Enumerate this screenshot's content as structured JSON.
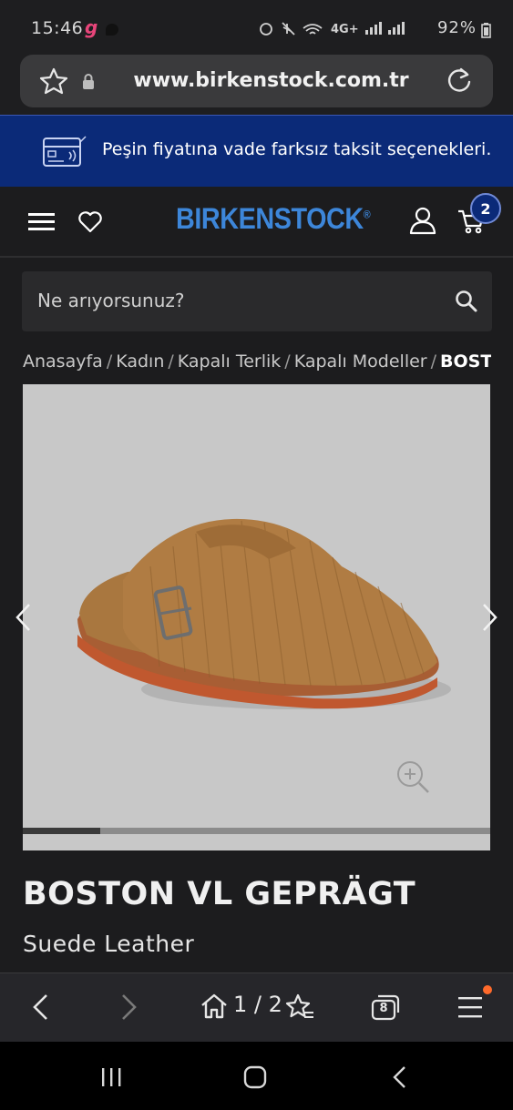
{
  "status_bar": {
    "time": "15:46",
    "app_glyph": "g",
    "battery": "92%",
    "icons": [
      "alarm-icon",
      "mute-icon",
      "wifi-icon",
      "signal-icon",
      "battery-icon"
    ]
  },
  "browser": {
    "url": "www.birkenstock.com.tr",
    "tab_counter": "8",
    "pager": "1 / 2"
  },
  "promo": {
    "text": "Peşin fiyatına vade farksız taksit seçenekleri."
  },
  "header": {
    "logo_text": "BIRKENSTOCK",
    "logo_mark": "®",
    "cart_count": "2"
  },
  "search": {
    "placeholder": "Ne arıyorsunuz?"
  },
  "breadcrumb": [
    {
      "label": "Anasayfa"
    },
    {
      "label": "Kadın"
    },
    {
      "label": "Kapalı Terlik"
    },
    {
      "label": "Kapalı Modeller"
    },
    {
      "label": "BOSTON VL GEPRÄGT"
    }
  ],
  "gallery": {
    "current_image": 1,
    "image_count": 6,
    "progress": 0.166
  },
  "product": {
    "name": "BOSTON VL GEPRÄGT",
    "material": "Suede Leather"
  },
  "colors": {
    "promo_bg": "#0b2a78",
    "logo": "#3d86d9",
    "background": "#1c1c1e",
    "notification_dot": "#ff6a2b"
  }
}
